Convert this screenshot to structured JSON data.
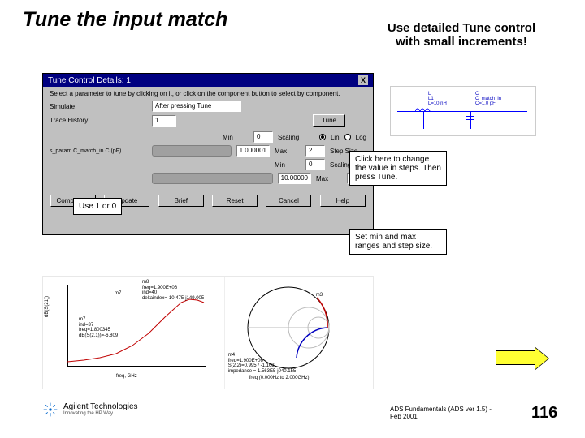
{
  "slide": {
    "title": "Tune the input match",
    "subtitle": "Use detailed Tune control with small increments!"
  },
  "dialog": {
    "title": "Tune Control Details: 1",
    "instruction": "Select a parameter to tune by clicking on it, or click on the component button to select by component.",
    "simulate_label": "Simulate",
    "simulate_value": "After pressing Tune",
    "trace_history_label": "Trace History",
    "trace_history_value": "1",
    "tune_label": "Tune",
    "slider1_label": "s_param.C_match_in.C (pF)",
    "slider2_label": "",
    "min_label": "Min",
    "max_label": "Max",
    "scaling_label": "Scaling",
    "step_label": "Step Size",
    "lin_label": "Lin",
    "log_label": "Log",
    "min1": "0",
    "max1": "2",
    "slider1_value": "1.000001",
    "min2": "0",
    "max2": "",
    "slider2_value": "10.00000",
    "buttons": {
      "component": "Component",
      "update": "Update",
      "brief": "Brief",
      "reset": "Reset",
      "cancel": "Cancel",
      "help": "Help"
    }
  },
  "callouts": {
    "use10": "Use 1 or 0",
    "click_change": "Click here to change the value in steps. Then press Tune.",
    "set_ranges": "Set min and max ranges and step size."
  },
  "schematic": {
    "l_block": "L\nL1\nL=10.nH",
    "c_block": "C\nC_match_in\nC=1.0 pF"
  },
  "chart_data": [
    {
      "type": "line",
      "title": "",
      "ylabel": "dB(S(21))",
      "xlabel": "freq, GHz",
      "ylim": [
        -45,
        -5
      ],
      "xlim": [
        0,
        2
      ],
      "markers": [
        {
          "name": "m7",
          "text": "m7\nind=37\nfreq=1.800345\ndB(S(2,1))=-6.809"
        },
        {
          "name": "m8",
          "text": "m8\nfreq=1.900E+06\nind=40\ndeltaindex=-10.475-j149.005"
        }
      ]
    },
    {
      "type": "smith",
      "title": "",
      "footer": "freq (0.000Hz to 2.000GHz)",
      "markers": [
        {
          "name": "m3",
          "pos": "upper-right"
        },
        {
          "name": "m4",
          "text": "m4\nfreq=1.900E+06\nS(2,2)=0.995 / -1.168\nimpedance = 1.563E5-j040.155"
        }
      ]
    }
  ],
  "footer": {
    "company": "Agilent Technologies",
    "tagline": "Innovating the HP Way",
    "course": "ADS Fundamentals (ADS ver 1.5) - Feb 2001",
    "page": "116"
  }
}
